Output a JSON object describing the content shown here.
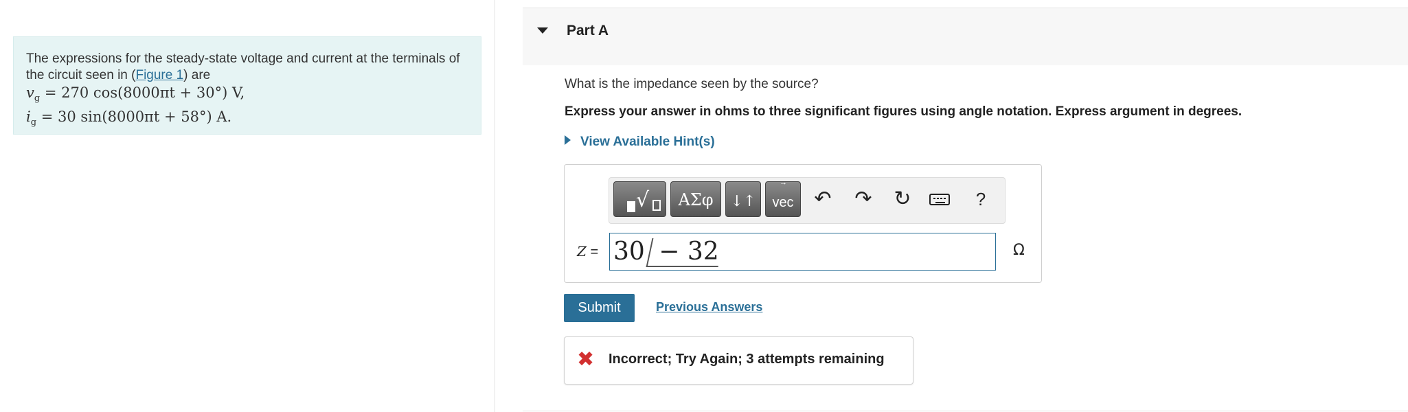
{
  "problem": {
    "text_before_link": "The expressions for the steady-state voltage and current at the terminals of the circuit seen in (",
    "link_label": "Figure 1",
    "text_after_link": ") are",
    "voltage_expr": "= 270 cos(8000πt + 30°) V,",
    "current_expr": "= 30 sin(8000πt + 58°) A."
  },
  "part": {
    "title": "Part A",
    "question": "What is the impedance seen by the source?",
    "instruction": "Express your answer in ohms to three significant figures using angle notation. Express argument in degrees.",
    "hint_label": "View Available Hint(s)"
  },
  "toolbar": {
    "greek_label": "ΑΣφ",
    "arrows_label": "↓↑",
    "vec_label": "vec",
    "help_label": "?"
  },
  "answer": {
    "variable": "Z",
    "equals": "=",
    "magnitude": "30",
    "angle": "− 32",
    "unit": "Ω"
  },
  "actions": {
    "submit_label": "Submit",
    "previous_answers_label": "Previous Answers"
  },
  "feedback": {
    "icon": "x-icon",
    "message": "Incorrect; Try Again; 3 attempts remaining"
  },
  "colors": {
    "accent": "#2a6f97",
    "problem_bg": "#e6f4f4",
    "error": "#d23030"
  }
}
